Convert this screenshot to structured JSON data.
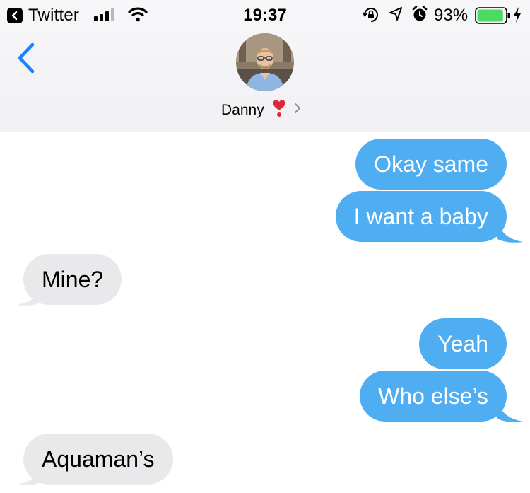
{
  "status_bar": {
    "back_app": "Twitter",
    "time": "19:37",
    "battery_percent": "93%",
    "signal_bars": 3,
    "battery_level": 0.93,
    "icons": [
      "chevron-left-icon",
      "signal-icon",
      "wifi-icon",
      "rotation-lock-icon",
      "location-icon",
      "alarm-icon",
      "battery-icon",
      "charging-bolt-icon"
    ]
  },
  "nav": {
    "contact_name": "Danny",
    "contact_emoji": "❣️",
    "back_icon": "chevron-left-icon",
    "details_icon": "chevron-right-icon"
  },
  "colors": {
    "sent_bubble": "#4fadf2",
    "received_bubble": "#e9e9eb",
    "accent": "#1a82fb",
    "header_bg": "#f3f3f5"
  },
  "messages": [
    {
      "from": "me",
      "text": "Okay same"
    },
    {
      "from": "me",
      "text": "I want a baby"
    },
    {
      "from": "them",
      "text": "Mine?"
    },
    {
      "from": "me",
      "text": "Yeah"
    },
    {
      "from": "me",
      "text": "Who else’s"
    },
    {
      "from": "them",
      "text": "Aquaman’s"
    }
  ]
}
